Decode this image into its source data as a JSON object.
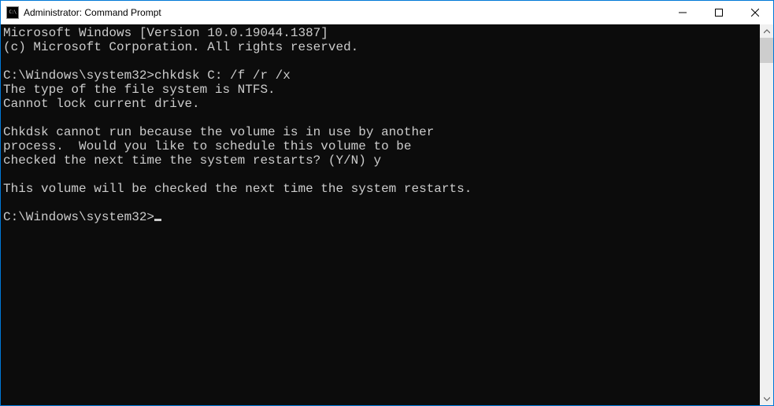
{
  "window": {
    "title": "Administrator: Command Prompt"
  },
  "console": {
    "lines": [
      "Microsoft Windows [Version 10.0.19044.1387]",
      "(c) Microsoft Corporation. All rights reserved.",
      "",
      "C:\\Windows\\system32>chkdsk C: /f /r /x",
      "The type of the file system is NTFS.",
      "Cannot lock current drive.",
      "",
      "Chkdsk cannot run because the volume is in use by another",
      "process.  Would you like to schedule this volume to be",
      "checked the next time the system restarts? (Y/N) y",
      "",
      "This volume will be checked the next time the system restarts.",
      "",
      "C:\\Windows\\system32>"
    ],
    "show_cursor_on_last": true
  }
}
